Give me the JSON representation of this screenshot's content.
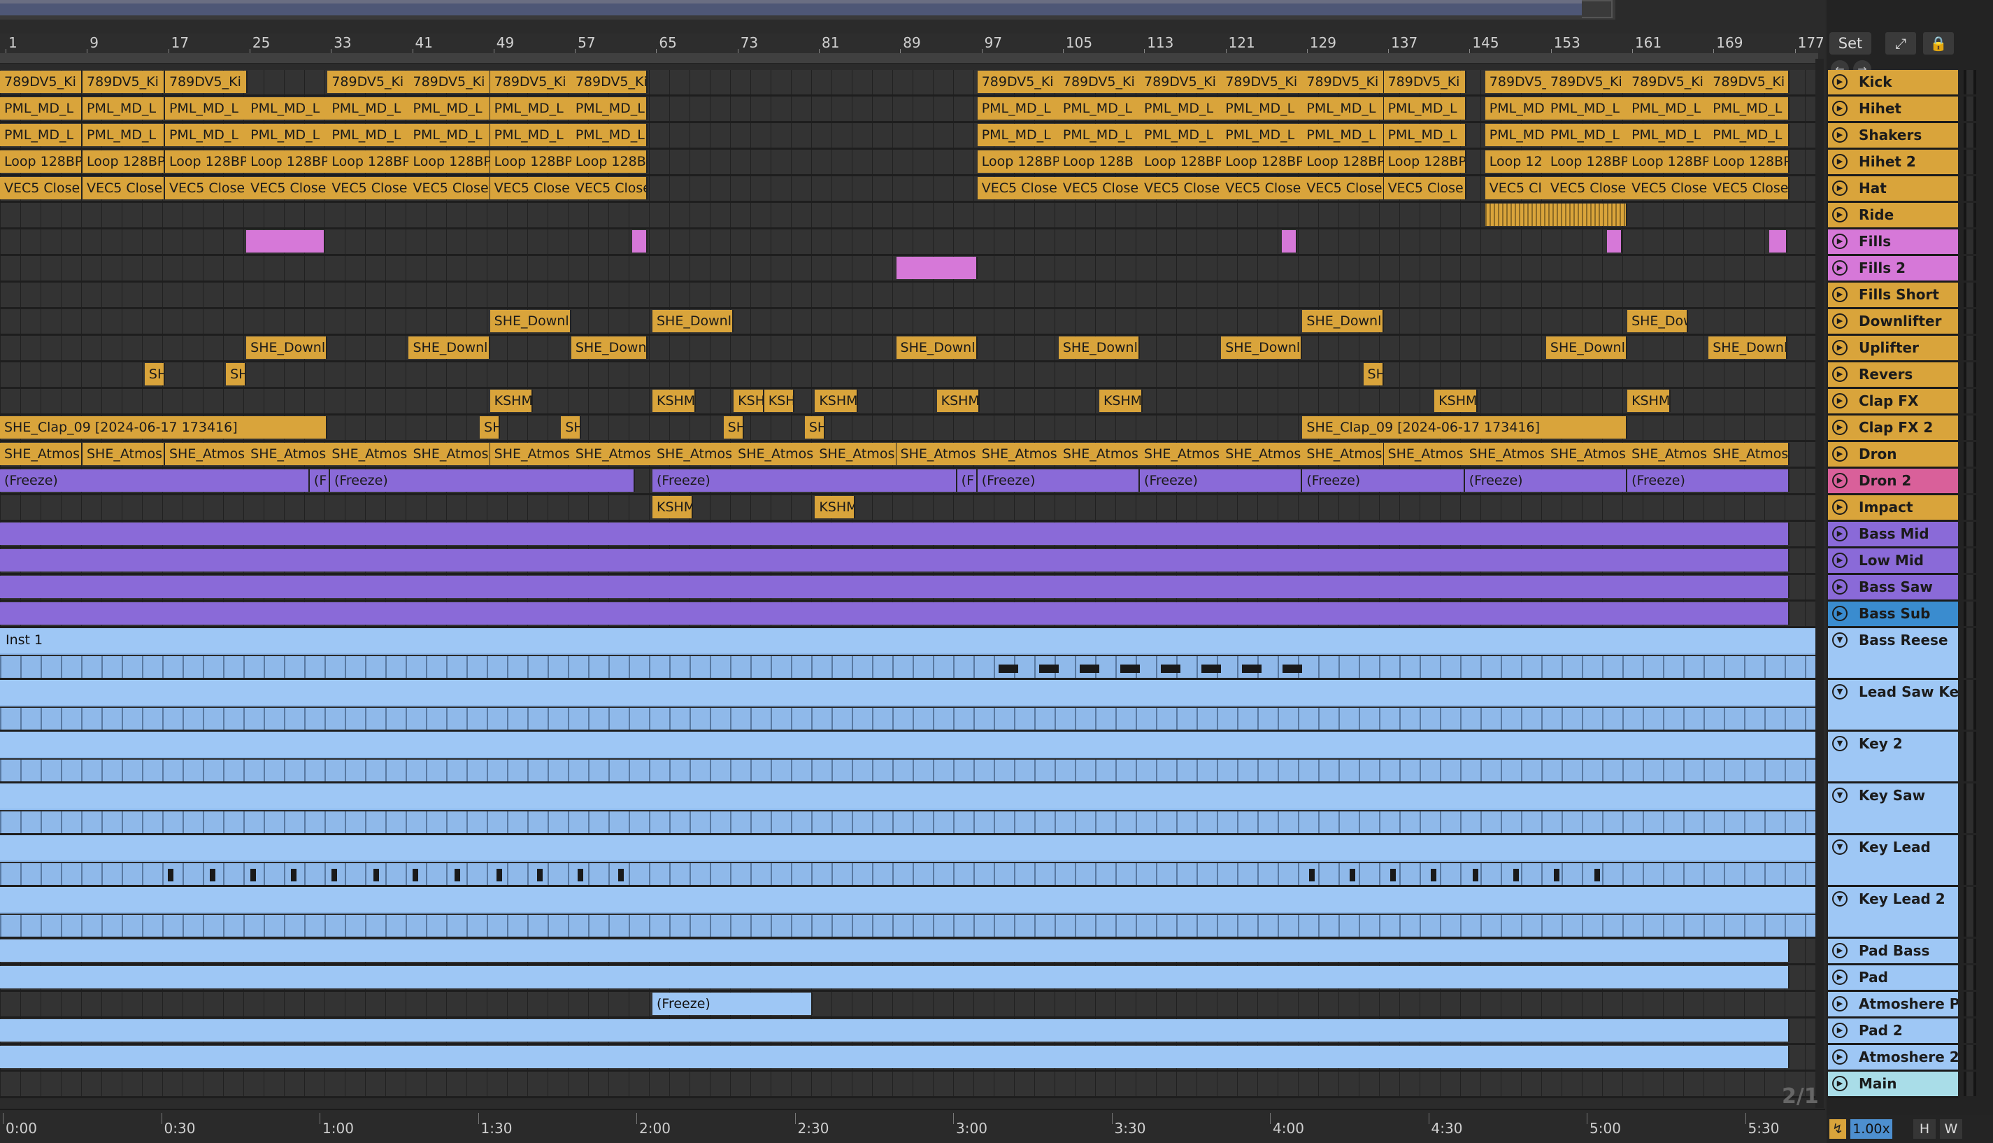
{
  "ruler": {
    "bars": [
      "1",
      "9",
      "17",
      "25",
      "33",
      "41",
      "49",
      "57",
      "65",
      "73",
      "81",
      "89",
      "97",
      "105",
      "113",
      "121",
      "129",
      "137",
      "145",
      "153",
      "161",
      "169",
      "177"
    ]
  },
  "timeline": {
    "labels": [
      "0:00",
      "0:30",
      "1:00",
      "1:30",
      "2:00",
      "2:30",
      "3:00",
      "3:30",
      "4:00",
      "4:30",
      "5:00",
      "5:30"
    ]
  },
  "counter": "2/1",
  "side": {
    "set_label": "Set",
    "zoom": "1.00x",
    "h_label": "H",
    "w_label": "W"
  },
  "colors": {
    "gold": "#d9a43b",
    "pink": "#d678d8",
    "purple": "#8a6ad8",
    "light_blue": "#9ec7f5",
    "dron2_header": "#d9609a",
    "bass_sub_header": "#3a8ccf",
    "main_header": "#a9dde8"
  },
  "tracks": [
    {
      "name": "Kick",
      "color": "gold",
      "clips": [
        [
          "789DV5_Ki",
          0,
          65
        ],
        [
          "789DV5_Ki",
          65,
          65
        ],
        [
          "789DV5_Ki",
          130,
          65
        ],
        [
          "789DV5_Ki",
          258,
          65
        ],
        [
          "789DV5_Ki",
          322,
          65
        ],
        [
          "789DV5_Ki",
          386,
          65
        ],
        [
          "789DV5_Ki",
          450,
          60
        ],
        [
          "789DV5_Ki",
          770,
          65
        ],
        [
          "789DV5_Ki",
          834,
          65
        ],
        [
          "789DV5_Ki",
          898,
          65
        ],
        [
          "789DV5_Ki",
          962,
          65
        ],
        [
          "789DV5_Ki",
          1026,
          65
        ],
        [
          "789DV5_Ki",
          1090,
          65
        ],
        [
          "789DV5_Ki",
          1170,
          50
        ],
        [
          "789DV5_Ki",
          1218,
          65
        ],
        [
          "789DV5_Ki",
          1282,
          65
        ],
        [
          "789DV5_Ki",
          1346,
          64
        ]
      ]
    },
    {
      "name": "Hihet",
      "color": "gold",
      "clips": [
        [
          "PML_MD_L",
          0,
          65
        ],
        [
          "PML_MD_L",
          65,
          65
        ],
        [
          "PML_MD_L",
          130,
          65
        ],
        [
          "PML_MD_L",
          194,
          65
        ],
        [
          "PML_MD_L",
          258,
          65
        ],
        [
          "PML_MD_L",
          322,
          65
        ],
        [
          "PML_MD_L",
          386,
          65
        ],
        [
          "PML_MD_L",
          450,
          60
        ],
        [
          "PML_MD_L",
          770,
          65
        ],
        [
          "PML_MD_L",
          834,
          65
        ],
        [
          "PML_MD_L",
          898,
          65
        ],
        [
          "PML_MD_L",
          962,
          65
        ],
        [
          "PML_MD_L",
          1026,
          65
        ],
        [
          "PML_MD_L",
          1090,
          65
        ],
        [
          "PML_MD",
          1170,
          50
        ],
        [
          "PML_MD_L",
          1218,
          65
        ],
        [
          "PML_MD_L",
          1282,
          65
        ],
        [
          "PML_MD_L",
          1346,
          64
        ]
      ]
    },
    {
      "name": "Shakers",
      "color": "gold",
      "clips": [
        [
          "PML_MD_L",
          0,
          65
        ],
        [
          "PML_MD_L",
          65,
          65
        ],
        [
          "PML_MD_L",
          130,
          65
        ],
        [
          "PML_MD_L",
          194,
          65
        ],
        [
          "PML_MD_L",
          258,
          65
        ],
        [
          "PML_MD_L",
          322,
          65
        ],
        [
          "PML_MD_L",
          386,
          65
        ],
        [
          "PML_MD_L",
          450,
          60
        ],
        [
          "PML_MD_L",
          770,
          65
        ],
        [
          "PML_MD_L",
          834,
          65
        ],
        [
          "PML_MD_L",
          898,
          65
        ],
        [
          "PML_MD_L",
          962,
          65
        ],
        [
          "PML_MD_L",
          1026,
          65
        ],
        [
          "PML_MD_L",
          1090,
          65
        ],
        [
          "PML_MD",
          1170,
          50
        ],
        [
          "PML_MD_L",
          1218,
          65
        ],
        [
          "PML_MD_L",
          1282,
          65
        ],
        [
          "PML_MD_L",
          1346,
          64
        ]
      ]
    },
    {
      "name": "Hihet 2",
      "color": "gold",
      "clips": [
        [
          "Loop 128BP",
          0,
          65
        ],
        [
          "Loop 128BP",
          65,
          65
        ],
        [
          "Loop 128BP",
          130,
          65
        ],
        [
          "Loop 128BP",
          194,
          65
        ],
        [
          "Loop 128BP",
          258,
          65
        ],
        [
          "Loop 128BP",
          322,
          65
        ],
        [
          "Loop 128BP",
          386,
          65
        ],
        [
          "Loop 128B",
          450,
          60
        ],
        [
          "Loop 128BP",
          770,
          65
        ],
        [
          "Loop 128B",
          834,
          65
        ],
        [
          "Loop 128BP",
          898,
          65
        ],
        [
          "Loop 128BP",
          962,
          65
        ],
        [
          "Loop 128BP",
          1026,
          65
        ],
        [
          "Loop 128BP",
          1090,
          65
        ],
        [
          "Loop 12",
          1170,
          50
        ],
        [
          "Loop 128BP",
          1218,
          65
        ],
        [
          "Loop 128BP",
          1282,
          65
        ],
        [
          "Loop 128BP",
          1346,
          64
        ]
      ]
    },
    {
      "name": "Hat",
      "color": "gold",
      "clips": [
        [
          "VEC5 Close",
          0,
          65
        ],
        [
          "VEC5 Close",
          65,
          65
        ],
        [
          "VEC5 Close",
          130,
          65
        ],
        [
          "VEC5 Close",
          194,
          65
        ],
        [
          "VEC5 Close",
          258,
          65
        ],
        [
          "VEC5 Close",
          322,
          65
        ],
        [
          "VEC5 Close",
          386,
          65
        ],
        [
          "VEC5 Close",
          450,
          60
        ],
        [
          "VEC5 Close",
          770,
          65
        ],
        [
          "VEC5 Close",
          834,
          65
        ],
        [
          "VEC5 Close",
          898,
          65
        ],
        [
          "VEC5 Close",
          962,
          65
        ],
        [
          "VEC5 Close",
          1026,
          65
        ],
        [
          "VEC5 Close",
          1090,
          65
        ],
        [
          "VEC5 Cl",
          1170,
          50
        ],
        [
          "VEC5 Close",
          1218,
          65
        ],
        [
          "VEC5 Close",
          1282,
          65
        ],
        [
          "VEC5 Close",
          1346,
          64
        ]
      ]
    },
    {
      "name": "Ride",
      "color": "gold",
      "clips": [
        [
          "",
          1170,
          112
        ]
      ]
    },
    {
      "name": "Fills",
      "color": "pink",
      "clips": [
        [
          "",
          194,
          62
        ],
        [
          "",
          498,
          12
        ],
        [
          "",
          1010,
          12
        ],
        [
          "",
          1266,
          12
        ],
        [
          "",
          1394,
          14
        ]
      ]
    },
    {
      "name": "Fills 2",
      "color": "pink",
      "clips": [
        [
          "",
          706,
          64
        ]
      ]
    },
    {
      "name": "Fills Short",
      "color": "gold",
      "clips": []
    },
    {
      "name": "Downlifter",
      "color": "gold",
      "clips": [
        [
          "SHE_Downl",
          386,
          64
        ],
        [
          "SHE_Downl",
          514,
          64
        ],
        [
          "SHE_Downl",
          1026,
          64
        ],
        [
          "SHE_Dow",
          1282,
          48
        ]
      ]
    },
    {
      "name": "Uplifter",
      "color": "gold",
      "clips": [
        [
          "SHE_Downl",
          194,
          64
        ],
        [
          "SHE_Downl",
          322,
          64
        ],
        [
          "SHE_Downl",
          450,
          60
        ],
        [
          "SHE_Downl",
          706,
          64
        ],
        [
          "SHE_Downl",
          834,
          64
        ],
        [
          "SHE_Downl",
          962,
          64
        ],
        [
          "SHE_Downl",
          1218,
          64
        ],
        [
          "SHE_Downl",
          1346,
          62
        ]
      ]
    },
    {
      "name": "Revers",
      "color": "gold",
      "clips": [
        [
          "SH",
          114,
          16
        ],
        [
          "SH",
          178,
          16
        ],
        [
          "SH",
          1074,
          16
        ]
      ]
    },
    {
      "name": "Clap FX",
      "color": "gold",
      "clips": [
        [
          "KSHM",
          386,
          34
        ],
        [
          "KSHM",
          514,
          34
        ],
        [
          "KSH",
          578,
          24
        ],
        [
          "KSH",
          602,
          24
        ],
        [
          "KSHM",
          642,
          34
        ],
        [
          "KSHM",
          738,
          34
        ],
        [
          "KSHM",
          866,
          34
        ],
        [
          "KSHM",
          1130,
          34
        ],
        [
          "KSHM",
          1282,
          34
        ]
      ]
    },
    {
      "name": "Clap FX 2",
      "color": "gold",
      "clips": [
        [
          "SHE_Clap_09 [2024-06-17 173416]",
          0,
          258
        ],
        [
          "SH",
          378,
          16
        ],
        [
          "SH",
          442,
          16
        ],
        [
          "SH",
          570,
          16
        ],
        [
          "SH",
          634,
          16
        ],
        [
          "SHE_Clap_09 [2024-06-17 173416]",
          1026,
          256
        ]
      ]
    },
    {
      "name": "Dron",
      "color": "gold",
      "clips": [
        [
          "SHE_Atmos",
          0,
          65
        ],
        [
          "SHE_Atmos",
          65,
          65
        ],
        [
          "SHE_Atmos",
          130,
          65
        ],
        [
          "SHE_Atmos",
          194,
          65
        ],
        [
          "SHE_Atmos",
          258,
          65
        ],
        [
          "SHE_Atmos",
          322,
          65
        ],
        [
          "SHE_Atmos",
          386,
          65
        ],
        [
          "SHE_Atmos",
          450,
          65
        ],
        [
          "SHE_Atmos",
          514,
          65
        ],
        [
          "SHE_Atmos",
          578,
          65
        ],
        [
          "SHE_Atmos",
          642,
          65
        ],
        [
          "SHE_Atmos",
          706,
          65
        ],
        [
          "SHE_Atmos",
          770,
          65
        ],
        [
          "SHE_Atmos",
          834,
          65
        ],
        [
          "SHE_Atmos",
          898,
          65
        ],
        [
          "SHE_Atmos",
          962,
          65
        ],
        [
          "SHE_Atmos",
          1026,
          65
        ],
        [
          "SHE_Atmos",
          1090,
          65
        ],
        [
          "SHE_Atmos",
          1154,
          65
        ],
        [
          "SHE_Atmos",
          1218,
          65
        ],
        [
          "SHE_Atmos",
          1282,
          65
        ],
        [
          "SHE_Atmos",
          1346,
          64
        ]
      ]
    },
    {
      "name": "Dron 2",
      "color": "purple",
      "clips": [
        [
          "(Freeze)",
          0,
          244
        ],
        [
          "(F",
          244,
          16
        ],
        [
          "(Freeze)",
          260,
          240
        ],
        [
          "(Freeze)",
          514,
          240
        ],
        [
          "(F",
          754,
          16
        ],
        [
          "(Freeze)",
          770,
          128
        ],
        [
          "(Freeze)",
          898,
          128
        ],
        [
          "(Freeze)",
          1026,
          128
        ],
        [
          "(Freeze)",
          1154,
          128
        ],
        [
          "(Freeze)",
          1282,
          128
        ]
      ]
    },
    {
      "name": "Impact",
      "color": "gold",
      "clips": [
        [
          "KSHM",
          514,
          32
        ],
        [
          "KSHM",
          642,
          32
        ]
      ]
    },
    {
      "name": "Bass Mid",
      "color": "purple",
      "clips": [
        [
          "",
          0,
          1410
        ]
      ]
    },
    {
      "name": "Low Mid",
      "color": "purple",
      "clips": [
        [
          "",
          0,
          1410
        ]
      ]
    },
    {
      "name": "Bass Saw",
      "color": "purple",
      "clips": [
        [
          "",
          0,
          1410
        ]
      ]
    },
    {
      "name": "Bass Sub",
      "color": "purple",
      "clips": [
        [
          "",
          0,
          1410
        ]
      ]
    },
    {
      "name": "Bass Reese",
      "color": "lblue",
      "inst": "Inst 1"
    },
    {
      "name": "Lead Saw Key",
      "color": "lblue",
      "inst": ""
    },
    {
      "name": "Key 2",
      "color": "lblue",
      "inst": ""
    },
    {
      "name": "Key Saw",
      "color": "lblue",
      "inst": ""
    },
    {
      "name": "Key Lead",
      "color": "lblue",
      "inst": ""
    },
    {
      "name": "Key Lead 2",
      "color": "lblue",
      "inst": ""
    },
    {
      "name": "Pad Bass",
      "color": "lblue",
      "clips": [
        [
          "",
          0,
          1410
        ]
      ]
    },
    {
      "name": "Pad",
      "color": "lblue",
      "clips": [
        [
          "",
          0,
          1410
        ]
      ]
    },
    {
      "name": "Atmoshere P",
      "color": "lblue",
      "clips": [
        [
          "(Freeze)",
          514,
          126
        ]
      ]
    },
    {
      "name": "Pad 2",
      "color": "lblue",
      "clips": [
        [
          "",
          0,
          1410
        ]
      ]
    },
    {
      "name": "Atmoshere 2",
      "color": "lblue",
      "clips": [
        [
          "",
          0,
          1410
        ]
      ]
    },
    {
      "name": "Main",
      "color": "main",
      "clips": []
    }
  ]
}
